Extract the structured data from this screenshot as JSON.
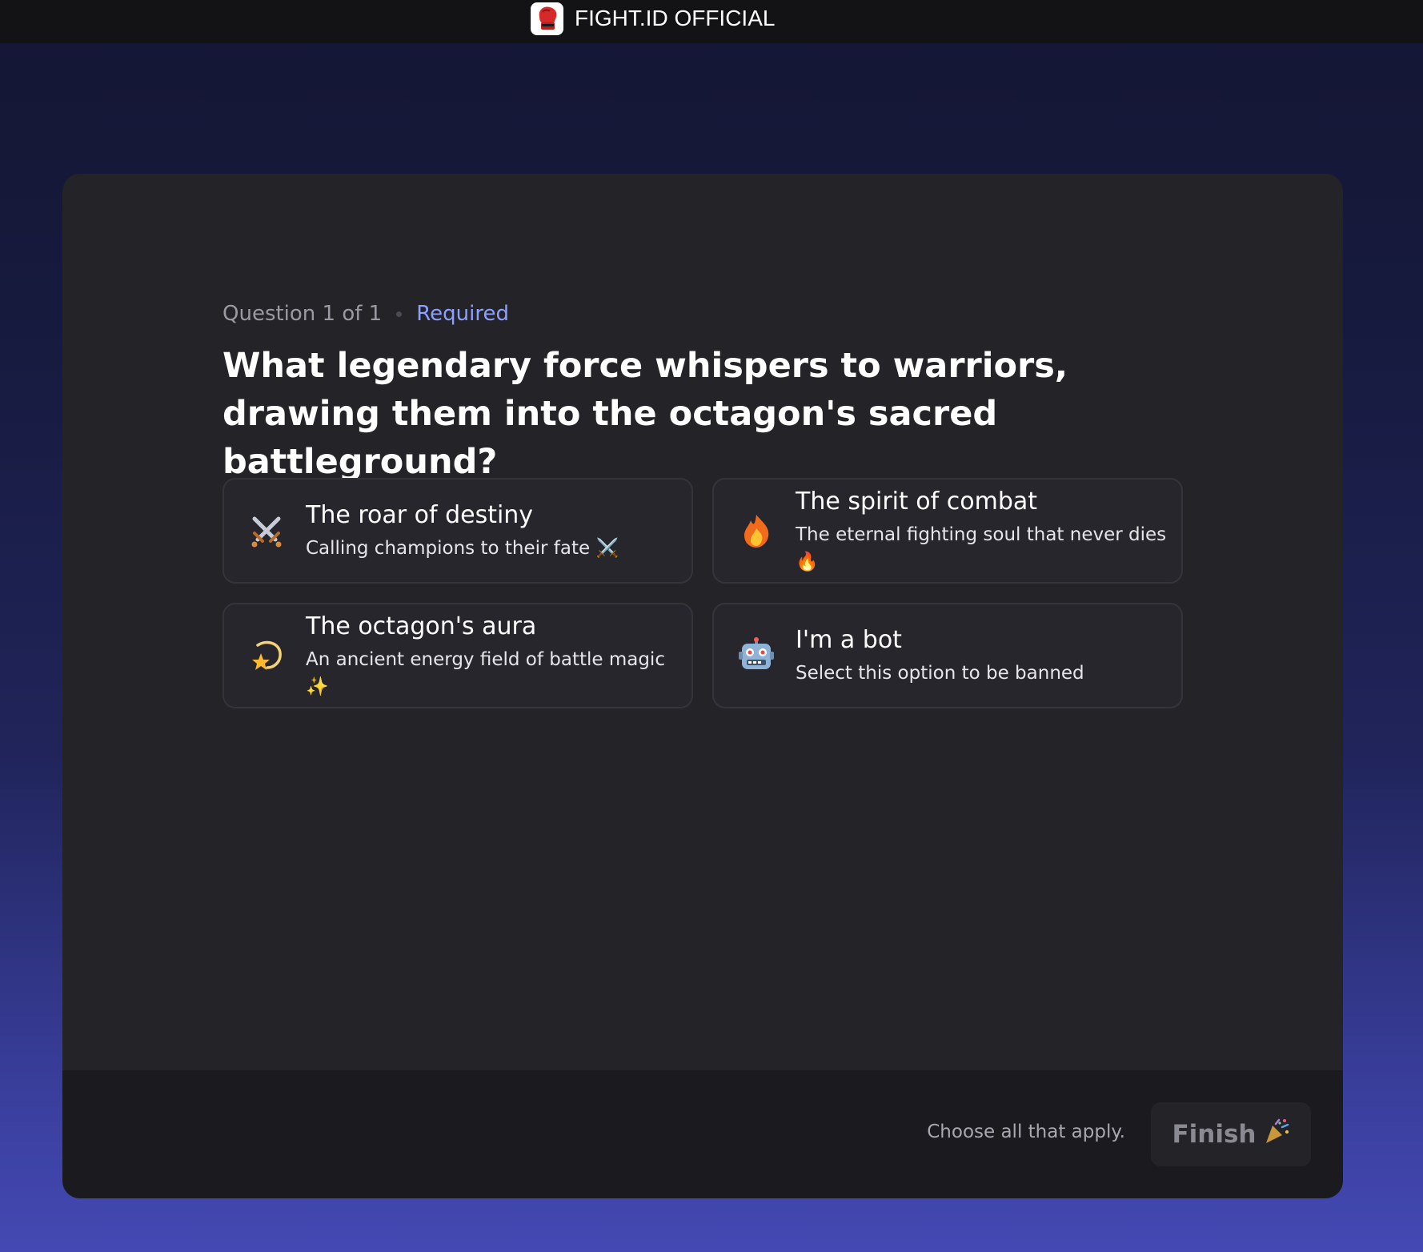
{
  "header": {
    "server_name": "FIGHT.ID OFFICIAL",
    "logo_icon": "boxing-glove-logo"
  },
  "question": {
    "counter": "Question 1 of 1",
    "required_label": "Required",
    "text": "What legendary force whispers to warriors, drawing them into the octagon's sacred battleground?",
    "options": [
      {
        "icon": "crossed-swords-icon",
        "title": "The roar of destiny",
        "subtitle": "Calling champions to their fate ⚔️"
      },
      {
        "icon": "fire-icon",
        "title": "The spirit of combat",
        "subtitle": "The eternal fighting soul that never dies 🔥"
      },
      {
        "icon": "dizzy-star-icon",
        "title": "The octagon's aura",
        "subtitle": "An ancient energy field of battle magic ✨"
      },
      {
        "icon": "robot-icon",
        "title": "I'm a bot",
        "subtitle": "Select this option to be banned"
      }
    ]
  },
  "footer": {
    "hint": "Choose all that apply.",
    "finish_label": "Finish",
    "finish_icon": "party-popper-icon"
  },
  "colors": {
    "accent": "#8da0ff",
    "card_bg": "#232328",
    "footer_bg": "#1b1b1f",
    "topbar_bg": "#131316"
  }
}
